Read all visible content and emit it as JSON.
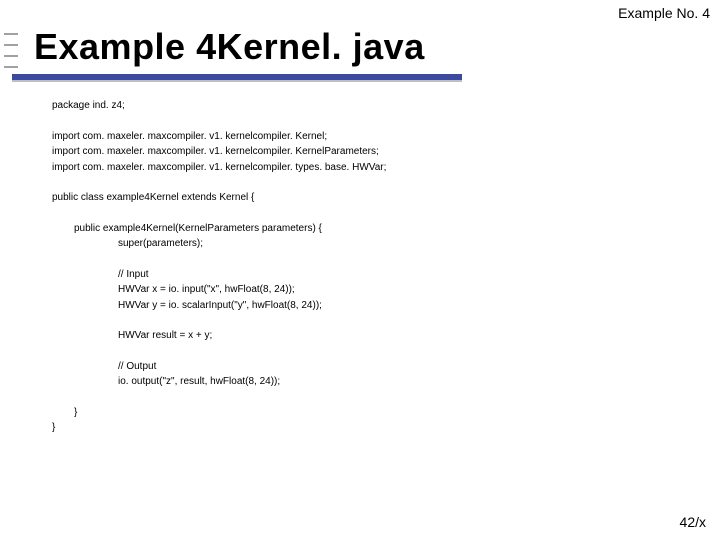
{
  "header": {
    "label": "Example No. 4"
  },
  "title": "Example 4Kernel. java",
  "code": {
    "pkg": "package ind. z4;",
    "imports": [
      "import com. maxeler. maxcompiler. v1. kernelcompiler. Kernel;",
      "import com. maxeler. maxcompiler. v1. kernelcompiler. KernelParameters;",
      "import com. maxeler. maxcompiler. v1. kernelcompiler. types. base. HWVar;"
    ],
    "classDecl": "public class example4Kernel extends Kernel {",
    "ctorDecl": "public example4Kernel(KernelParameters parameters) {",
    "superCall": "super(parameters);",
    "cInput": "// Input",
    "inX": "HWVar x = io. input(\"x\", hwFloat(8, 24));",
    "inY": "HWVar y = io. scalarInput(\"y\", hwFloat(8, 24));",
    "result": "HWVar result = x + y;",
    "cOutput": "// Output",
    "out": "io. output(\"z\", result, hwFloat(8, 24));",
    "closeCtor": "}",
    "closeClass": "}"
  },
  "footer": {
    "page": "42/x"
  }
}
